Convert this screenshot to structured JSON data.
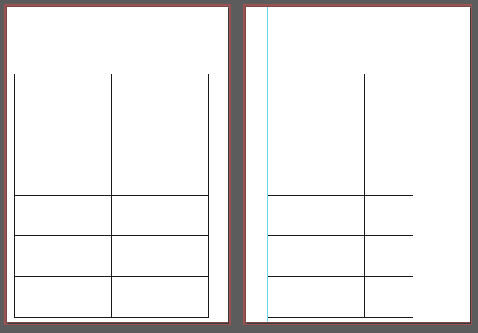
{
  "canvas": {
    "background": "#5c5c5c",
    "page_fill": "#ffffff",
    "page_border": "#9c5252",
    "guide_color": "#6fd8e6",
    "grid_line": "#1a1a1a"
  },
  "spread": {
    "pages": [
      {
        "side": "left",
        "grid": {
          "columns": 4,
          "rows": 6
        }
      },
      {
        "side": "right",
        "grid": {
          "columns": 3,
          "rows": 6
        }
      }
    ]
  }
}
